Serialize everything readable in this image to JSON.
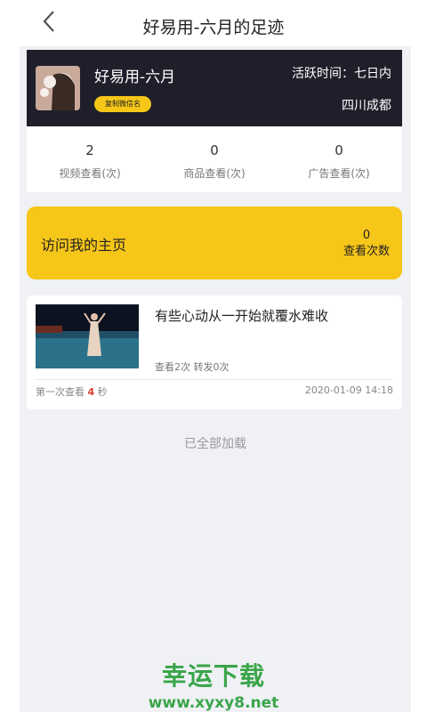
{
  "header": {
    "title": "好易用-六月的足迹"
  },
  "profile": {
    "name": "好易用-六月",
    "copy_button": "复制微信名",
    "active_time": "活跃时间：七日内",
    "location": "四川成都"
  },
  "stats": [
    {
      "value": "2",
      "label": "视频查看(次)"
    },
    {
      "value": "0",
      "label": "商品查看(次)"
    },
    {
      "value": "0",
      "label": "广告查看(次)"
    }
  ],
  "visit": {
    "label": "访问我的主页",
    "count": "0",
    "count_label": "查看次数"
  },
  "video": {
    "title": "有些心动从一开始就覆水难收",
    "meta": "查看2次  转发0次",
    "first_prefix": "第一次查看",
    "first_seconds": "4",
    "first_suffix": "秒",
    "date": "2020-01-09 14:18"
  },
  "footer": {
    "all_loaded": "已全部加载"
  },
  "watermark": {
    "line1": "幸运下载",
    "line2": "www.xyxy8.net"
  }
}
